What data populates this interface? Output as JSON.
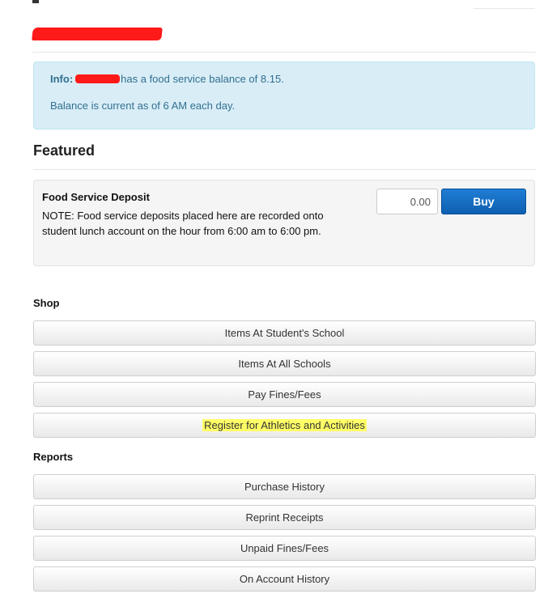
{
  "info": {
    "label": "Info:",
    "balance_text": "has a food service balance of 8.15.",
    "current_text": "Balance is current as of 6 AM each day."
  },
  "featured": {
    "title": "Featured",
    "item_title": "Food Service Deposit",
    "item_note": "NOTE: Food service deposits placed here are recorded onto student lunch account on the hour from 6:00 am to 6:00 pm.",
    "amount_value": "0.00",
    "buy_label": "Buy"
  },
  "shop": {
    "heading": "Shop",
    "items": [
      {
        "label": "Items At Student's School"
      },
      {
        "label": "Items At All Schools"
      },
      {
        "label": "Pay Fines/Fees"
      },
      {
        "label": "Register for Athletics and Activities"
      }
    ]
  },
  "reports": {
    "heading": "Reports",
    "items": [
      {
        "label": "Purchase History"
      },
      {
        "label": "Reprint Receipts"
      },
      {
        "label": "Unpaid Fines/Fees"
      },
      {
        "label": "On Account History"
      }
    ]
  },
  "colors": {
    "info_bg": "#d9edf7",
    "info_text": "#31708f",
    "buy_button": "#1a73c9",
    "redaction": "#ff1a1a",
    "highlight": "#ffff66"
  }
}
